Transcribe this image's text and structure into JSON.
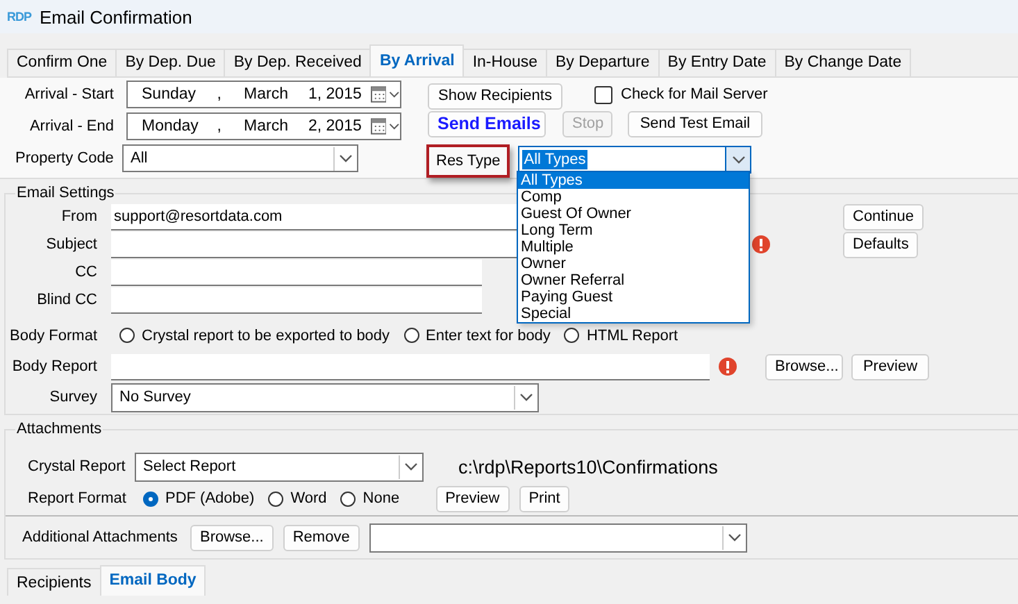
{
  "window": {
    "logo": "RDP",
    "title": "Email Confirmation"
  },
  "tabs": [
    {
      "label": "Confirm One",
      "selected": false
    },
    {
      "label": "By Dep. Due",
      "selected": false
    },
    {
      "label": "By Dep. Received",
      "selected": false
    },
    {
      "label": "By Arrival",
      "selected": true
    },
    {
      "label": "In-House",
      "selected": false
    },
    {
      "label": "By Departure",
      "selected": false
    },
    {
      "label": "By Entry Date",
      "selected": false
    },
    {
      "label": "By Change Date",
      "selected": false
    }
  ],
  "arrival_start": {
    "label": "Arrival - Start",
    "parts": [
      "Sunday",
      ",",
      "March",
      "1, 2015"
    ]
  },
  "arrival_end": {
    "label": "Arrival - End",
    "parts": [
      "Monday",
      ",",
      "March",
      "2, 2015"
    ]
  },
  "property_code": {
    "label": "Property Code",
    "value": "All"
  },
  "show_recipients": {
    "label": "Show Recipients"
  },
  "mail_server_check": {
    "label": "Check for Mail Server",
    "checked": false
  },
  "send_emails": {
    "label": "Send Emails",
    "disabled": false
  },
  "stop": {
    "label": "Stop",
    "disabled": true
  },
  "send_test": {
    "label": "Send Test Email",
    "disabled": false
  },
  "res_type": {
    "label": "Res Type",
    "value": "All Types",
    "expanded": true,
    "options": [
      {
        "label": "All Types",
        "selected": true
      },
      {
        "label": "Comp",
        "selected": false
      },
      {
        "label": "Guest Of Owner",
        "selected": false
      },
      {
        "label": "Long Term",
        "selected": false
      },
      {
        "label": "Multiple",
        "selected": false
      },
      {
        "label": "Owner",
        "selected": false
      },
      {
        "label": "Owner Referral",
        "selected": false
      },
      {
        "label": "Paying Guest",
        "selected": false
      },
      {
        "label": "Special",
        "selected": false
      }
    ]
  },
  "email_settings": {
    "title": "Email Settings",
    "from": {
      "label": "From",
      "value": "support@resortdata.com"
    },
    "subject": {
      "label": "Subject",
      "error": true
    },
    "cc": {
      "label": "CC"
    },
    "blind_cc": {
      "label": "Blind CC"
    },
    "body_format": {
      "label": "Body Format",
      "options": [
        {
          "label": "Crystal report to be exported to body",
          "selected": false
        },
        {
          "label": "Enter text for body",
          "selected": false
        },
        {
          "label": "HTML Report",
          "selected": false
        }
      ]
    },
    "body_report": {
      "label": "Body Report",
      "error": true,
      "buttons": [
        "Browse...",
        "Preview"
      ]
    },
    "survey": {
      "label": "Survey",
      "value": "No Survey"
    },
    "side_buttons": [
      "Continue",
      "Defaults"
    ]
  },
  "attachments": {
    "title": "Attachments",
    "crystal_report": {
      "label": "Crystal Report",
      "value": "Select Report"
    },
    "path": "c:\\rdp\\Reports10\\Confirmations",
    "report_format": {
      "label": "Report  Format",
      "options": [
        {
          "label": "PDF (Adobe)",
          "selected": true
        },
        {
          "label": "Word",
          "selected": false
        },
        {
          "label": "None",
          "selected": false
        }
      ]
    },
    "report_buttons": [
      "Preview",
      "Print"
    ],
    "additional": {
      "label": "Additional Attachments",
      "buttons": [
        "Browse...",
        "Remove"
      ]
    }
  },
  "bottom_tabs": [
    {
      "label": "Recipients",
      "selected": false
    },
    {
      "label": "Email Body",
      "selected": true
    }
  ]
}
